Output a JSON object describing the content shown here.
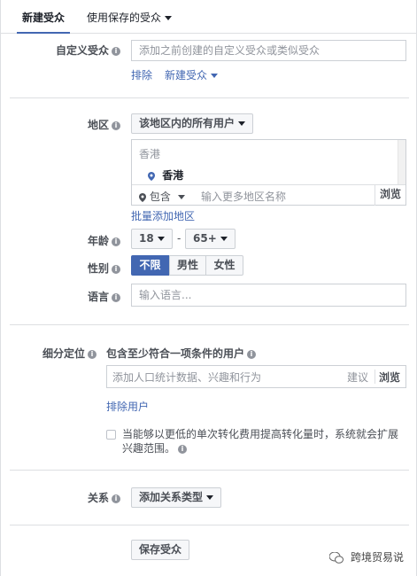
{
  "tabs": {
    "new_audience": "新建受众",
    "use_saved": "使用保存的受众"
  },
  "custom_audience": {
    "label": "自定义受众",
    "placeholder": "添加之前创建的自定义受众或类似受众",
    "exclude": "排除",
    "create_new": "新建受众"
  },
  "location": {
    "label": "地区",
    "scope": "该地区内的所有用户",
    "group_header": "香港",
    "selected": "香港",
    "include": "包含",
    "placeholder": "输入更多地区名称",
    "browse": "浏览",
    "bulk_add": "批量添加地区"
  },
  "age": {
    "label": "年龄",
    "min": "18",
    "dash": "-",
    "max": "65+"
  },
  "gender": {
    "label": "性别",
    "options": [
      "不限",
      "男性",
      "女性"
    ]
  },
  "language": {
    "label": "语言",
    "placeholder": "输入语言..."
  },
  "detailed_targeting": {
    "label": "细分定位",
    "include_text": "包含至少符合一项条件的用户",
    "placeholder": "添加人口统计数据、兴趣和行为",
    "suggestions": "建议",
    "browse": "浏览",
    "exclude": "排除用户",
    "expand_text": "当能够以更低的单次转化费用提高转化量时，系统就会扩展兴趣范围。"
  },
  "connections": {
    "label": "关系",
    "button": "添加关系类型"
  },
  "save_button": "保存受众",
  "watermark": "跨境贸易说",
  "info_glyph": "i",
  "colors": {
    "link": "#4267b2",
    "active": "#4267b2",
    "border": "#ccd0d5"
  }
}
